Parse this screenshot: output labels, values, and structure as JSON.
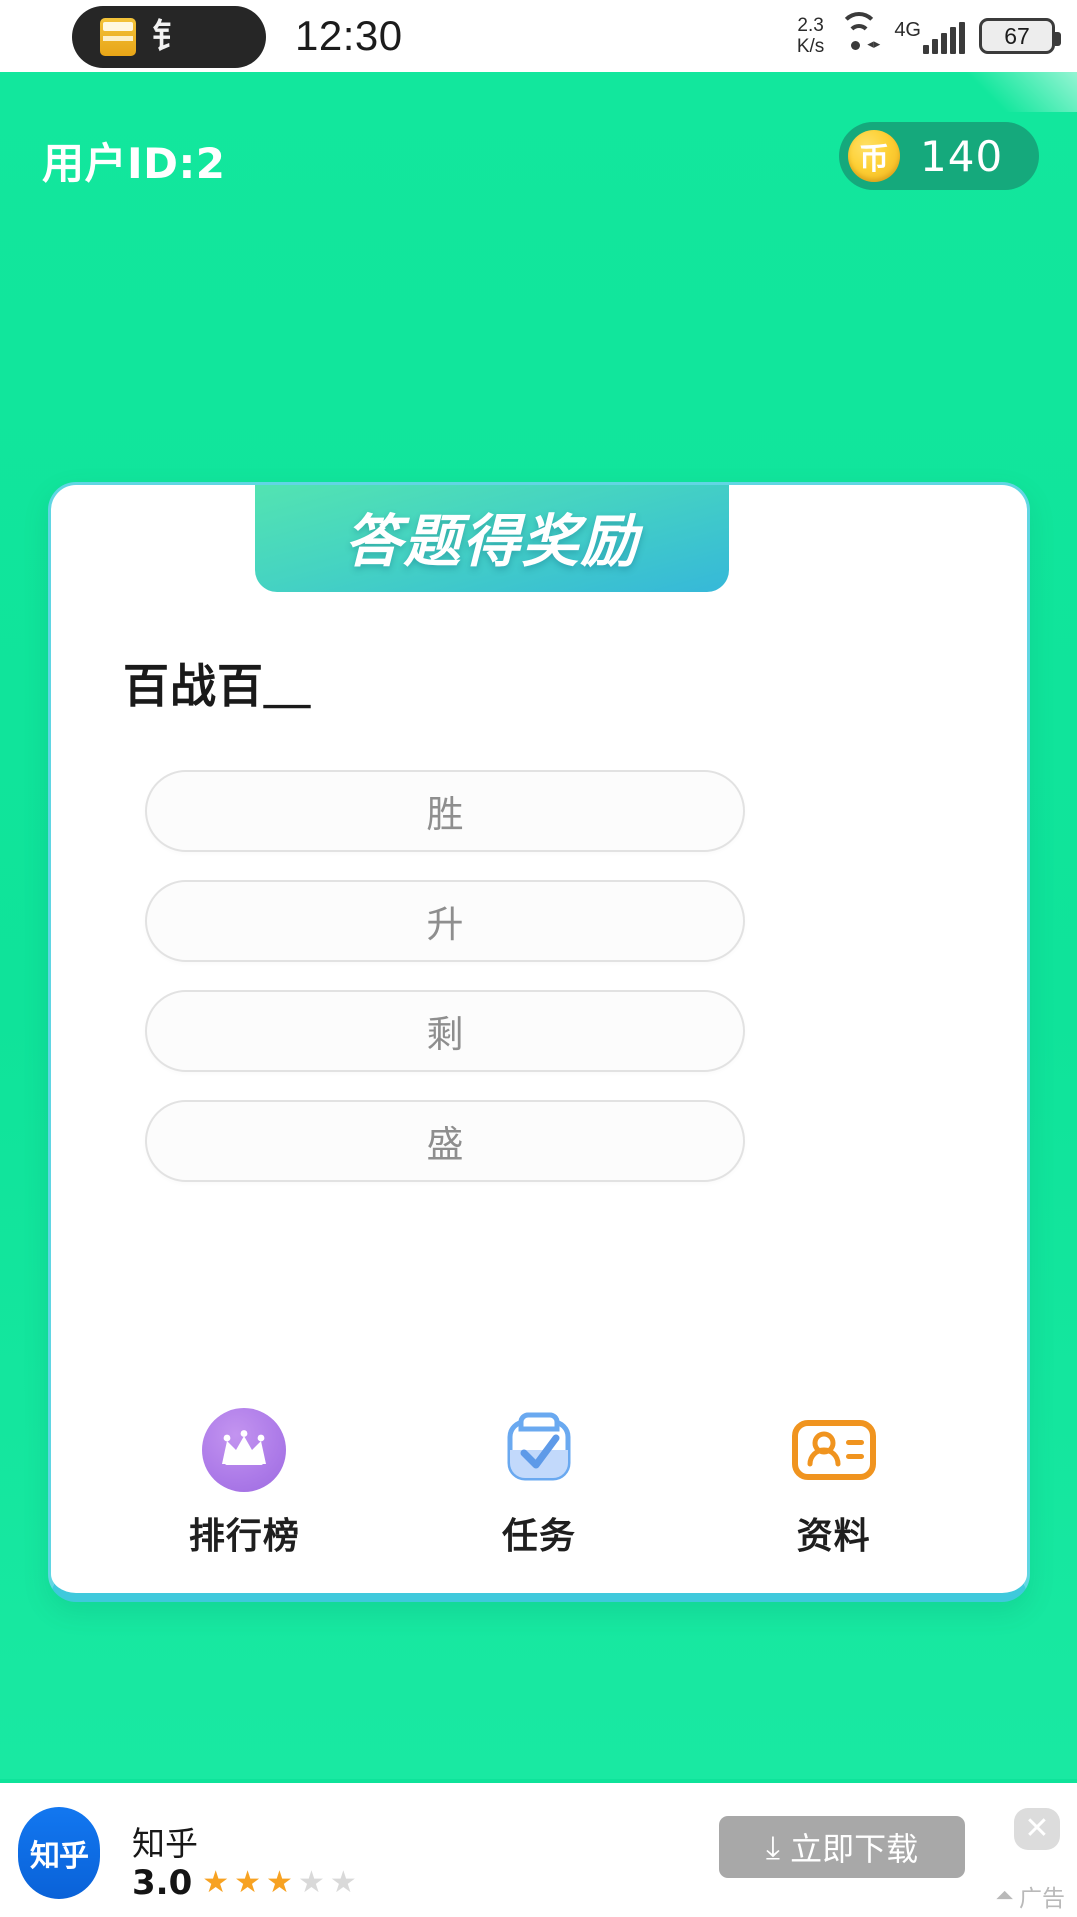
{
  "statusbar": {
    "time": "12:30",
    "netspeed_value": "2.3",
    "netspeed_unit": "K/s",
    "network_type": "4G",
    "battery": "67",
    "notch_glyph": "⻐",
    "icons": [
      "store-icon",
      "wifi-icon",
      "signal-icon",
      "battery-icon"
    ]
  },
  "header": {
    "user_id": "用户ID:2",
    "coin_symbol": "币",
    "coin_amount": "140"
  },
  "card": {
    "banner_title": "答题得奖励",
    "question": "百战百＿",
    "options": [
      {
        "label": "胜"
      },
      {
        "label": "升"
      },
      {
        "label": "剩"
      },
      {
        "label": "盛"
      }
    ],
    "nav": [
      {
        "label": "排行榜",
        "icon": "crown-icon"
      },
      {
        "label": "任务",
        "icon": "clipboard-check-icon"
      },
      {
        "label": "资料",
        "icon": "id-card-icon"
      }
    ]
  },
  "ad": {
    "logo_text": "知乎",
    "app_name": "知乎",
    "score": "3.0",
    "stars_filled": 3,
    "stars_total": 5,
    "download_label": "立即下载",
    "download_icon": "download-icon",
    "close_icon": "close-icon",
    "ad_label": "广告"
  },
  "colors": {
    "page_green": "#0fe39a",
    "coin_pill": "#15a97c",
    "card_border": "#61d6e3",
    "banner_from": "#53e4b1",
    "banner_to": "#36b8d9",
    "crown_purple": "#ac7ae8",
    "clipboard_blue": "#6aa9f0",
    "idcard_orange": "#f0941f",
    "star_on": "#f7a222",
    "ad_logo_blue": "#0a62d8"
  }
}
